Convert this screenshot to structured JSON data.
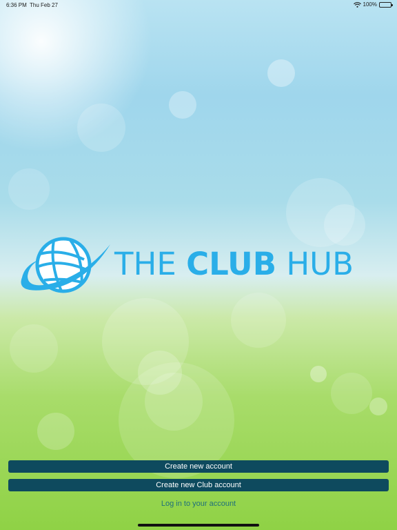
{
  "status_bar": {
    "time": "6:36 PM",
    "date": "Thu Feb 27",
    "battery": "100%"
  },
  "logo": {
    "word_the": "THE",
    "word_club": "CLUB",
    "word_hub": "HUB",
    "color": "#2aaee8"
  },
  "actions": {
    "create_account": "Create new account",
    "create_club_account": "Create new Club account",
    "login": "Log in to your account"
  },
  "colors": {
    "button_bg": "#0e4a5e",
    "button_text": "#ffffff",
    "link_text": "#1f6f7a"
  }
}
